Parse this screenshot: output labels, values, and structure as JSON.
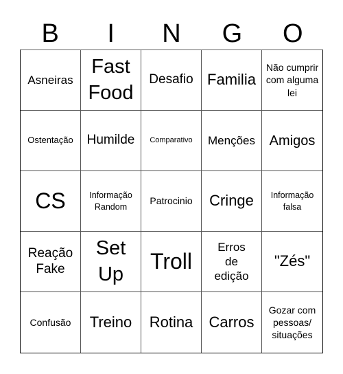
{
  "header": {
    "letters": [
      "B",
      "I",
      "N",
      "G",
      "O"
    ]
  },
  "cells": [
    "Asneiras",
    "Fast Food",
    "Desafio",
    "Familia",
    "Não cumprir com alguma lei",
    "Ostentação",
    "Humilde",
    "Comparativo",
    "Menções",
    "Amigos",
    "CS",
    "Informação Random",
    "Patrocinio",
    "Cringe",
    "Informação falsa",
    "Reação Fake",
    "Set Up",
    "Troll",
    "Erros de edição",
    "\"Zés\"",
    "Confusão",
    "Treino",
    "Rotina",
    "Carros",
    "Gozar com pessoas/ situações"
  ]
}
